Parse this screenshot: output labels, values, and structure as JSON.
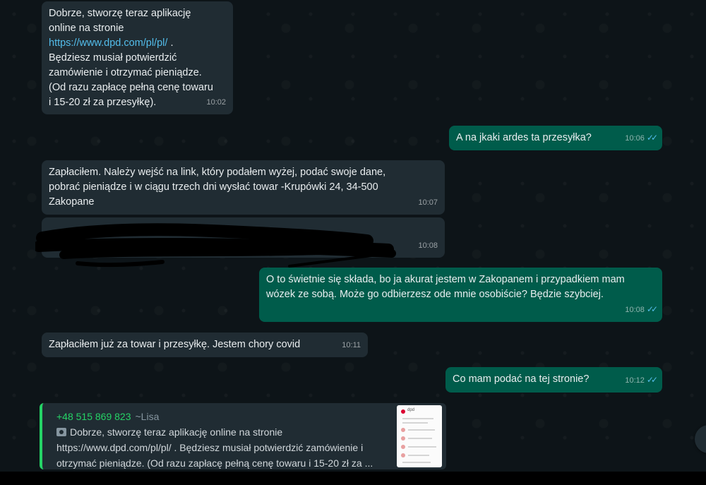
{
  "messages": [
    {
      "id": "m1",
      "dir": "in",
      "text": "Dobrze, stworzę teraz aplikację\nonline na stronie",
      "link": "https://www.dpd.com/pl/pl/",
      "after_link": " .\nBędziesz musiał potwierdzić\nzamówienie i otrzymać pieniądze.\n(Od razu zapłacę pełną cenę towaru\ni 15-20 zł za przesyłkę).",
      "time": "10:02"
    },
    {
      "id": "m2",
      "dir": "out",
      "text": "A na jkaki ardes ta przesyłka?",
      "time": "10:06"
    },
    {
      "id": "m3",
      "dir": "in",
      "text": "Zapłaciłem. Należy wejść na link, który podałem wyżej, podać swoje dane,\npobrać pieniądze i w ciągu trzech dni wysłać towar -Krupówki 24, 34-500\nZakopane",
      "time": "10:07"
    },
    {
      "id": "m4",
      "dir": "in",
      "text": "",
      "time": "10:08"
    },
    {
      "id": "m5",
      "dir": "out",
      "text": "O to świetnie się składa, bo ja akurat jestem w Zakopanem i przypadkiem mam\nwózek ze sobą. Może go odbierzesz ode mnie osobiście? Będzie szybciej.",
      "time": "10:08"
    },
    {
      "id": "m6",
      "dir": "in",
      "text": "Zapłaciłem już za towar i przesyłkę.  Jestem chory covid",
      "time": "10:11"
    },
    {
      "id": "m7",
      "dir": "out",
      "text": "Co mam podać na tej stronie?",
      "time": "10:12"
    }
  ],
  "quote": {
    "sender": "+48 515 869 823",
    "sender_name": "~Lisa",
    "line1": "Dobrze, stworzę teraz aplikację online na stronie",
    "line2": "https://www.dpd.com/pl/pl/ . Będziesz musiał potwierdzić zamówienie i",
    "line3": "otrzymać pieniądze. (Od razu zapłacę pełną cenę towaru i 15-20 zł za ...",
    "thumbnail_icon": "document-thumbnail-icon",
    "thumb_brand": "dpd"
  },
  "icons": {
    "read_ticks": "double-check-icon",
    "camera": "camera-icon"
  },
  "colors": {
    "incoming": "#202c33",
    "outgoing": "#005c4b",
    "link": "#53bdeb",
    "ticks": "#53bdeb",
    "quote_accent": "#25d366"
  }
}
